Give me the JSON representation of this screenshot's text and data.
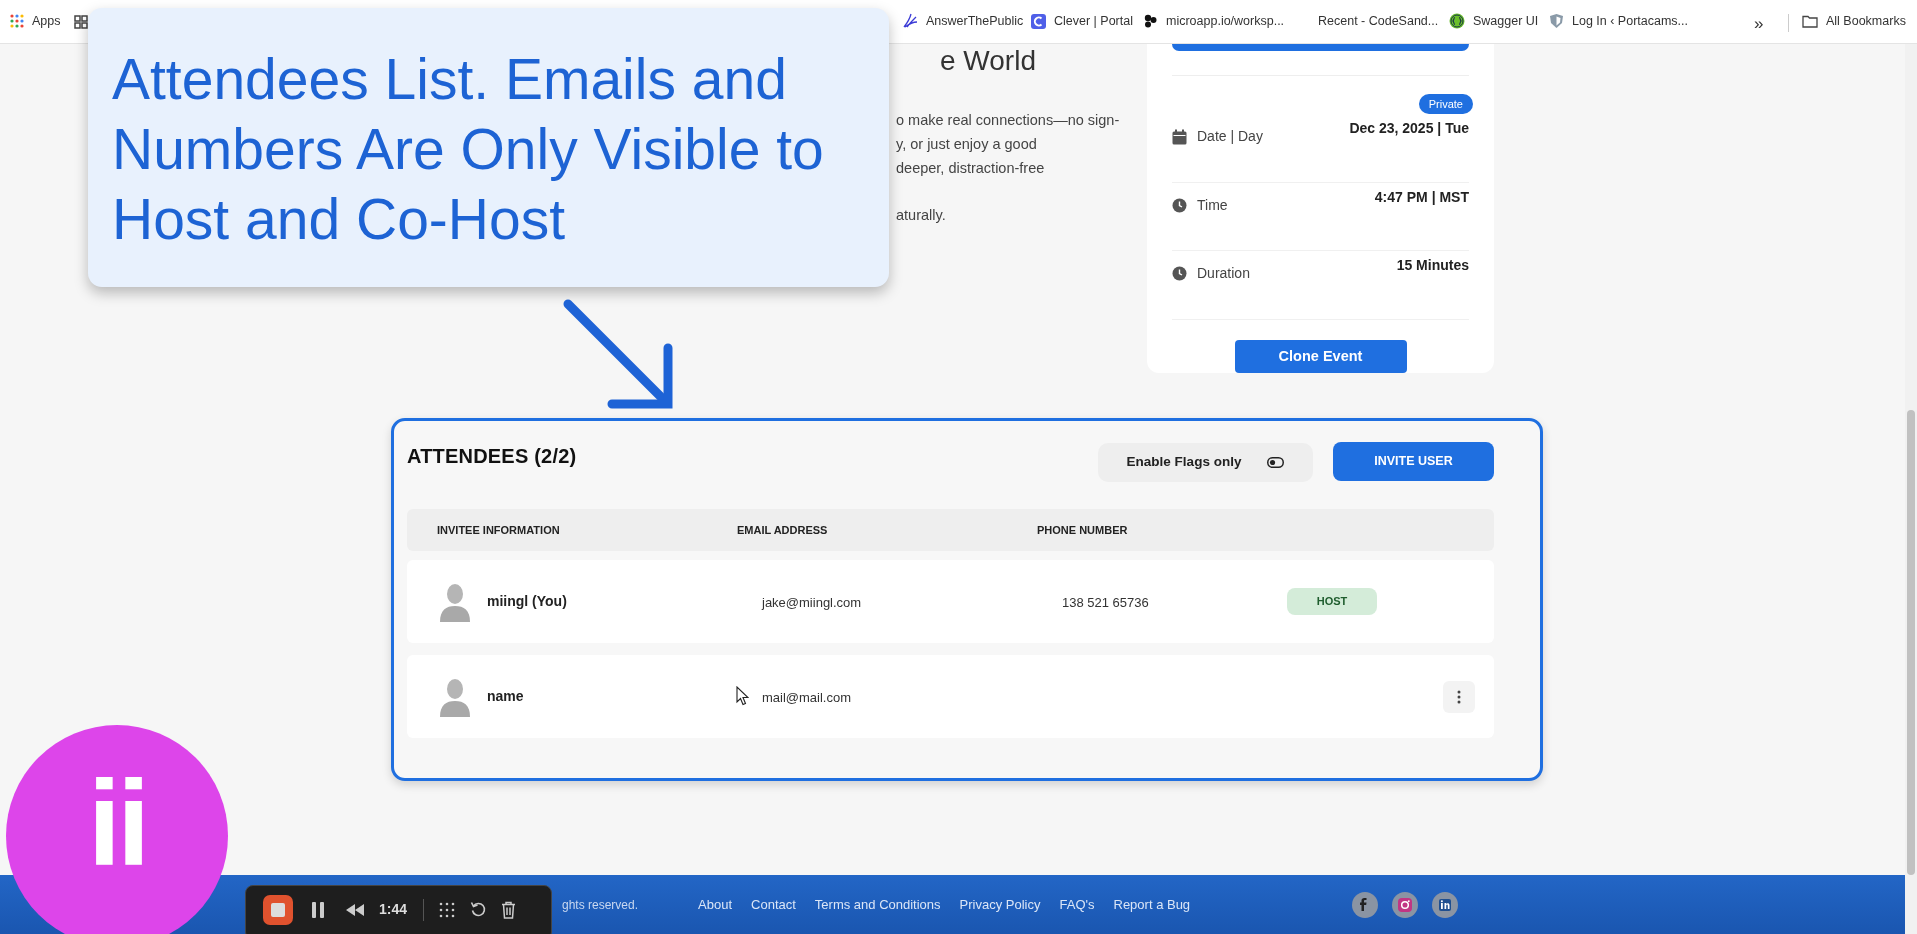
{
  "bookmarks": [
    {
      "kind": "apps",
      "label": "Apps"
    },
    {
      "kind": "grid"
    },
    {
      "kind": "feather",
      "label": "AnswerThePublic"
    },
    {
      "kind": "clever",
      "label": "Clever | Portal"
    },
    {
      "kind": "dots",
      "label": "microapp.io/worksp..."
    },
    {
      "kind": "none",
      "label": "Recent - CodeSand..."
    },
    {
      "kind": "swagger",
      "label": "Swagger UI"
    },
    {
      "kind": "shield",
      "label": "Log In ‹ Portacams..."
    },
    {
      "kind": "overflow",
      "label": "»"
    },
    {
      "kind": "folder",
      "label": "All Bookmarks"
    }
  ],
  "callout": {
    "text": "Attendees List. Emails and Numbers Are Only Visible to Host and Co-Host"
  },
  "event": {
    "heading_fragment": "e World",
    "paragraphs": [
      [
        "o make real connections—no sign-",
        "y, or just enjoy a good",
        "deeper, distraction-free"
      ],
      [
        "aturally."
      ]
    ]
  },
  "event_card": {
    "badge": "Private",
    "details": [
      {
        "kind": "calendar",
        "label": "Date | Day",
        "value": "Dec 23, 2025 | Tue"
      },
      {
        "kind": "clock",
        "label": "Time",
        "value": "4:47 PM | MST"
      },
      {
        "kind": "clock",
        "label": "Duration",
        "value": "15 Minutes"
      }
    ],
    "clone_button": "Clone Event"
  },
  "attendees": {
    "title": "ATTENDEES (2/2)",
    "flags_toggle": {
      "label": "Enable Flags only",
      "on": false
    },
    "invite_button": "INVITE USER",
    "columns": [
      "INVITEE INFORMATION",
      "EMAIL ADDRESS",
      "PHONE NUMBER"
    ],
    "rows": [
      {
        "name": "miingl (You)",
        "email": "jake@miingl.com",
        "phone": "138 521 65736",
        "role": "HOST",
        "has_menu": false
      },
      {
        "name": "name",
        "email": "mail@mail.com",
        "has_menu": true
      }
    ]
  },
  "footer": {
    "copyright_fragment": "ghts reserved.",
    "links": [
      "About",
      "Contact",
      "Terms and Conditions",
      "Privacy Policy",
      "FAQ's",
      "Report a Bug"
    ],
    "socials": [
      {
        "kind": "facebook"
      },
      {
        "kind": "instagram"
      },
      {
        "kind": "linkedin"
      }
    ]
  },
  "recorder": {
    "time": "1:44"
  },
  "logo": {
    "text": "ii"
  }
}
